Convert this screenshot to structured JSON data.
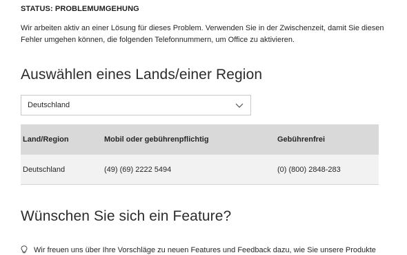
{
  "status": {
    "heading": "STATUS: PROBLEMUMGEHUNG",
    "text": "Wir arbeiten aktiv an einer Lösung für dieses Problem. Verwenden Sie in der Zwischenzeit, damit Sie diesen Fehler umgehen können, die folgenden Telefonnummern, um Office zu aktivieren."
  },
  "region_section": {
    "title": "Auswählen eines Lands/einer Region",
    "select": {
      "value": "Deutschland",
      "icon": "chevron-down-icon"
    }
  },
  "phone_table": {
    "headers": [
      "Land/Region",
      "Mobil oder gebührenpflichtig",
      "Gebührenfrei"
    ],
    "rows": [
      [
        "Deutschland",
        "(49) (69) 2222 5494",
        "(0) (800) 2848-283"
      ]
    ]
  },
  "feature_section": {
    "title": "Wünschen Sie sich ein Feature?",
    "text": "Wir freuen uns über Ihre Vorschläge zu neuen Features und Feedback dazu, wie Sie unsere Produkte",
    "icon": "lightbulb-icon"
  },
  "colors": {
    "text": "#262626",
    "table_header_bg": "#d9d9d9",
    "table_row_bg": "#f2f2f2",
    "border": "#c8c8c8"
  }
}
